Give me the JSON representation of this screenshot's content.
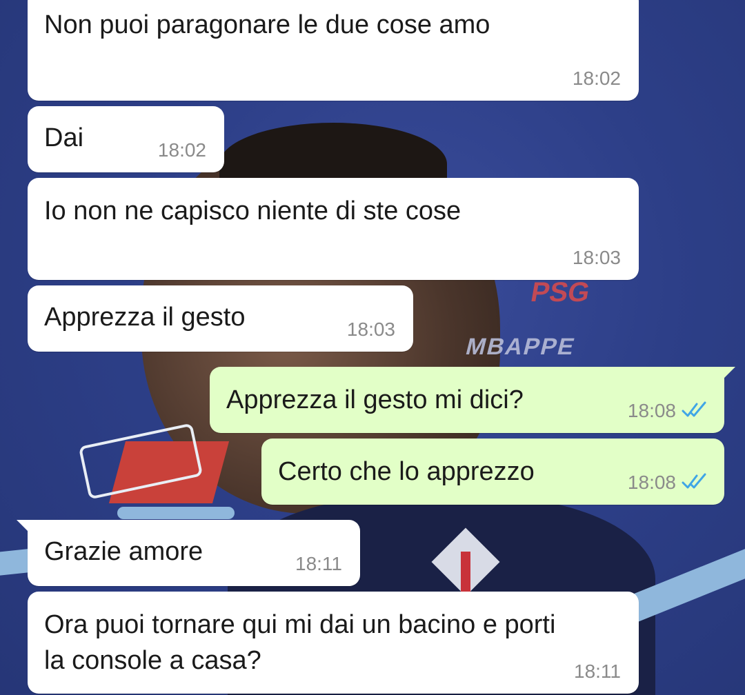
{
  "colors": {
    "incoming_bubble": "#ffffff",
    "outgoing_bubble": "#e2ffc7",
    "timestamp": "#8a8a8a",
    "read_ticks": "#3fa5e6",
    "wallpaper": "#2b3d86"
  },
  "wallpaper": {
    "text_top": "PSG",
    "text_bottom": "MBAPPE"
  },
  "messages": [
    {
      "direction": "incoming",
      "text": "Non puoi paragonare le due cose amo",
      "time": "18:02"
    },
    {
      "direction": "incoming",
      "text": "Dai",
      "time": "18:02"
    },
    {
      "direction": "incoming",
      "text": "Io non ne capisco niente di ste cose",
      "time": "18:03"
    },
    {
      "direction": "incoming",
      "text": "Apprezza il gesto",
      "time": "18:03"
    },
    {
      "direction": "outgoing",
      "text": "Apprezza il gesto mi dici?",
      "time": "18:08",
      "status_icon": "double-check-read-icon"
    },
    {
      "direction": "outgoing",
      "text": "Certo che lo apprezzo",
      "time": "18:08",
      "status_icon": "double-check-read-icon"
    },
    {
      "direction": "incoming",
      "text": "Grazie amore",
      "time": "18:11"
    },
    {
      "direction": "incoming",
      "text": "Ora puoi tornare qui mi dai un bacino e porti la console a casa?",
      "time": "18:11"
    }
  ]
}
